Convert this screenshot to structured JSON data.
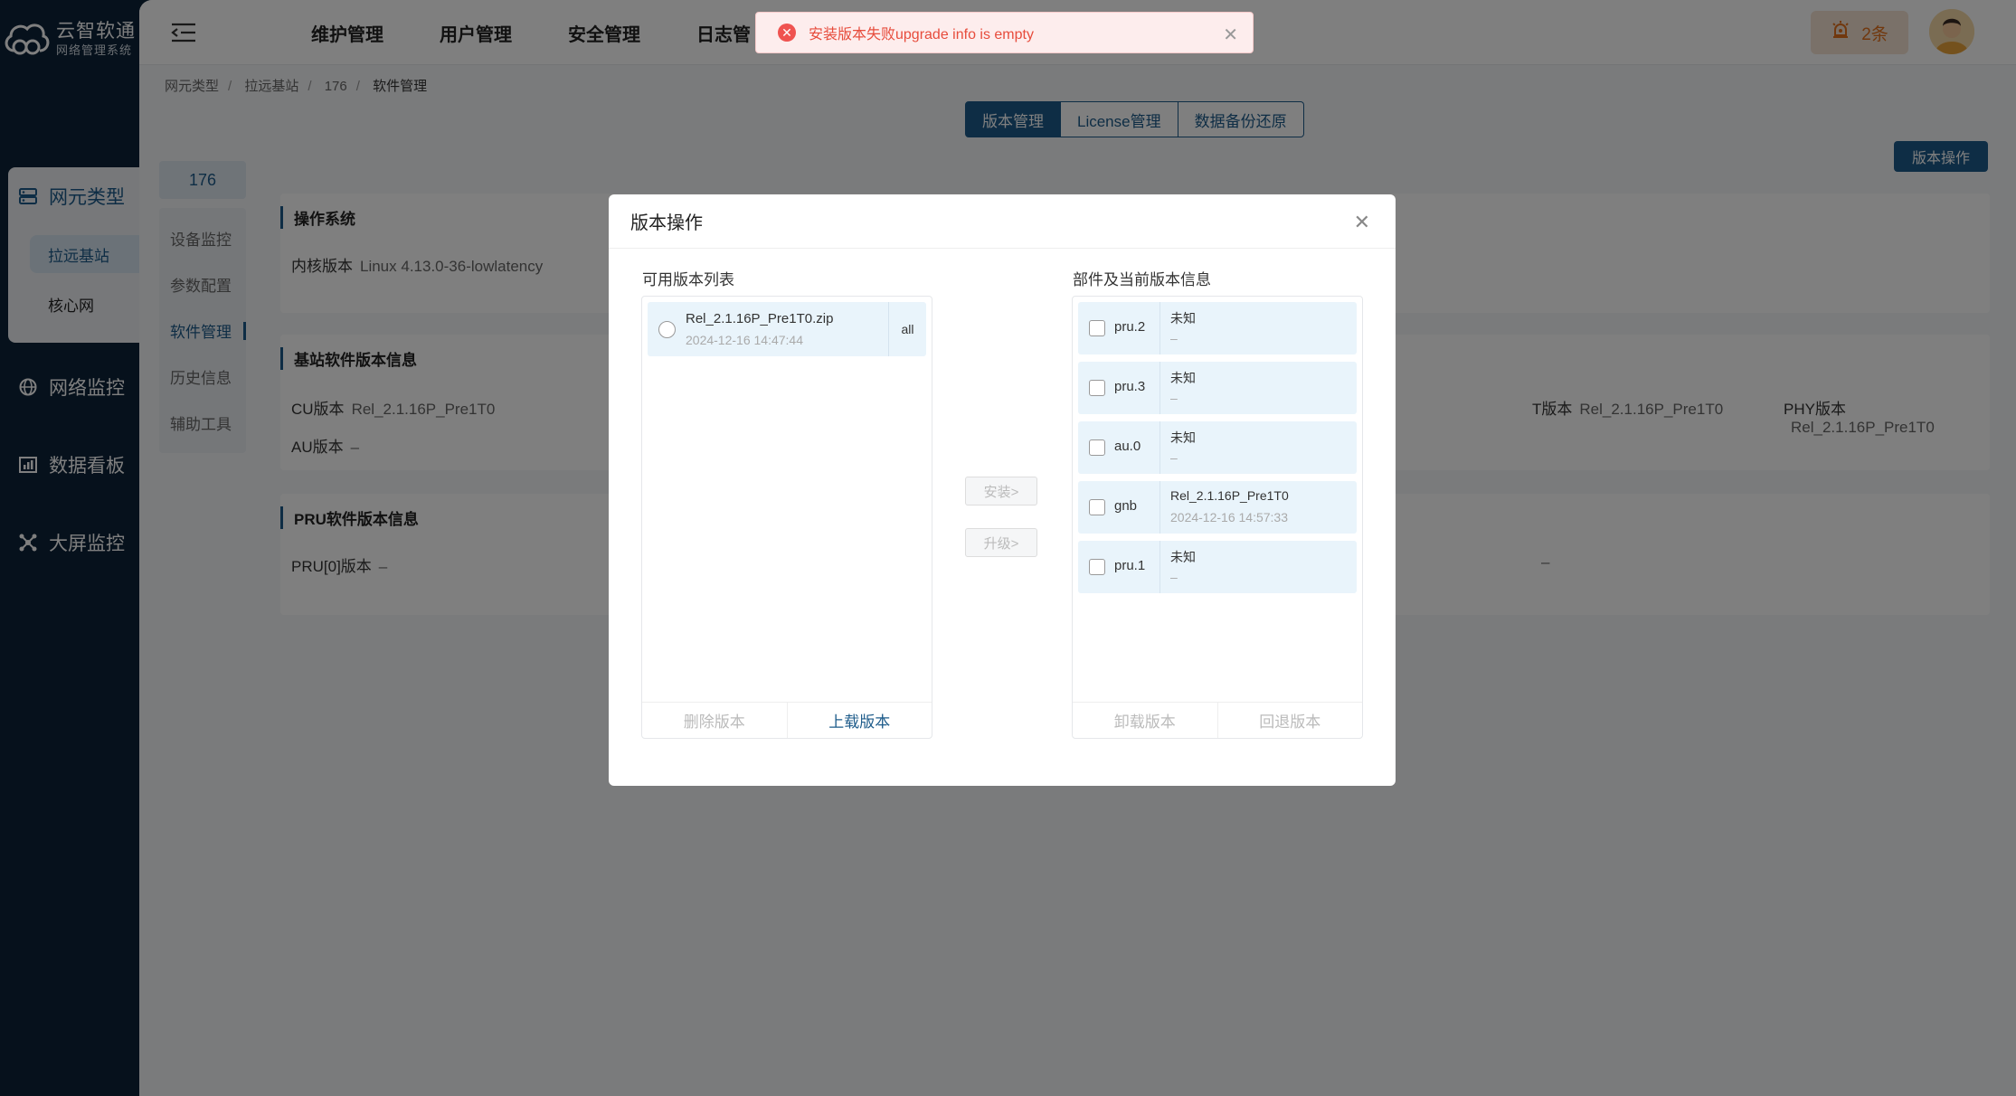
{
  "brand": {
    "title": "云智软通",
    "subtitle": "网络管理系统"
  },
  "sidebar": {
    "items": [
      {
        "label": "网元类型",
        "icon": "server-icon"
      },
      {
        "label": "网络监控",
        "icon": "globe-icon"
      },
      {
        "label": "数据看板",
        "icon": "chart-icon"
      },
      {
        "label": "大屏监控",
        "icon": "hub-icon"
      }
    ],
    "sub_items": [
      {
        "label": "拉远基站"
      },
      {
        "label": "核心网"
      }
    ]
  },
  "topnav": {
    "items": [
      "维护管理",
      "用户管理",
      "安全管理",
      "日志管"
    ]
  },
  "header": {
    "alarm_count": "2条"
  },
  "breadcrumb": {
    "items": [
      "网元类型",
      "拉远基站",
      "176",
      "软件管理"
    ]
  },
  "tabs": [
    "版本管理",
    "License管理",
    "数据备份还原"
  ],
  "actions": {
    "version_op": "版本操作"
  },
  "subnav": {
    "title": "176",
    "items": [
      "设备监控",
      "参数配置",
      "软件管理",
      "历史信息",
      "辅助工具"
    ]
  },
  "cards": {
    "os": {
      "title": "操作系统",
      "kernel_label": "内核版本",
      "kernel_value": "Linux 4.13.0-36-lowlatency"
    },
    "bs": {
      "title": "基站软件版本信息",
      "cu_label": "CU版本",
      "cu_value": "Rel_2.1.16P_Pre1T0",
      "au_label": "AU版本",
      "au_value": "–",
      "mid_label": "版本",
      "mid_prefix": "T",
      "mid_value": "Rel_2.1.16P_Pre1T0",
      "phy_label": "PHY版本",
      "phy_value": "Rel_2.1.16P_Pre1T0"
    },
    "pru": {
      "title": "PRU软件版本信息",
      "pru0_label": "PRU[0]版本",
      "pru0_value": "–",
      "right_value": "–"
    }
  },
  "toast": {
    "message": "安装版本失败upgrade info is empty"
  },
  "modal": {
    "title": "版本操作",
    "left_label": "可用版本列表",
    "right_label": "部件及当前版本信息",
    "versions": [
      {
        "name": "Rel_2.1.16P_Pre1T0.zip",
        "date": "2024-12-16 14:47:44",
        "tag": "all"
      }
    ],
    "components": [
      {
        "name": "pru.2",
        "version": "未知",
        "date": "–"
      },
      {
        "name": "pru.3",
        "version": "未知",
        "date": "–"
      },
      {
        "name": "au.0",
        "version": "未知",
        "date": "–"
      },
      {
        "name": "gnb",
        "version": "Rel_2.1.16P_Pre1T0",
        "date": "2024-12-16 14:57:33"
      },
      {
        "name": "pru.1",
        "version": "未知",
        "date": "–"
      }
    ],
    "install_label": "安装>",
    "upgrade_label": "升级>",
    "delete_label": "删除版本",
    "upload_label": "上载版本",
    "uninstall_label": "卸载版本",
    "rollback_label": "回退版本"
  },
  "colors": {
    "primary": "#1d5b8a",
    "sidebar": "#0c2338",
    "error": "#e74c3c",
    "alarm": "#e2711d"
  }
}
